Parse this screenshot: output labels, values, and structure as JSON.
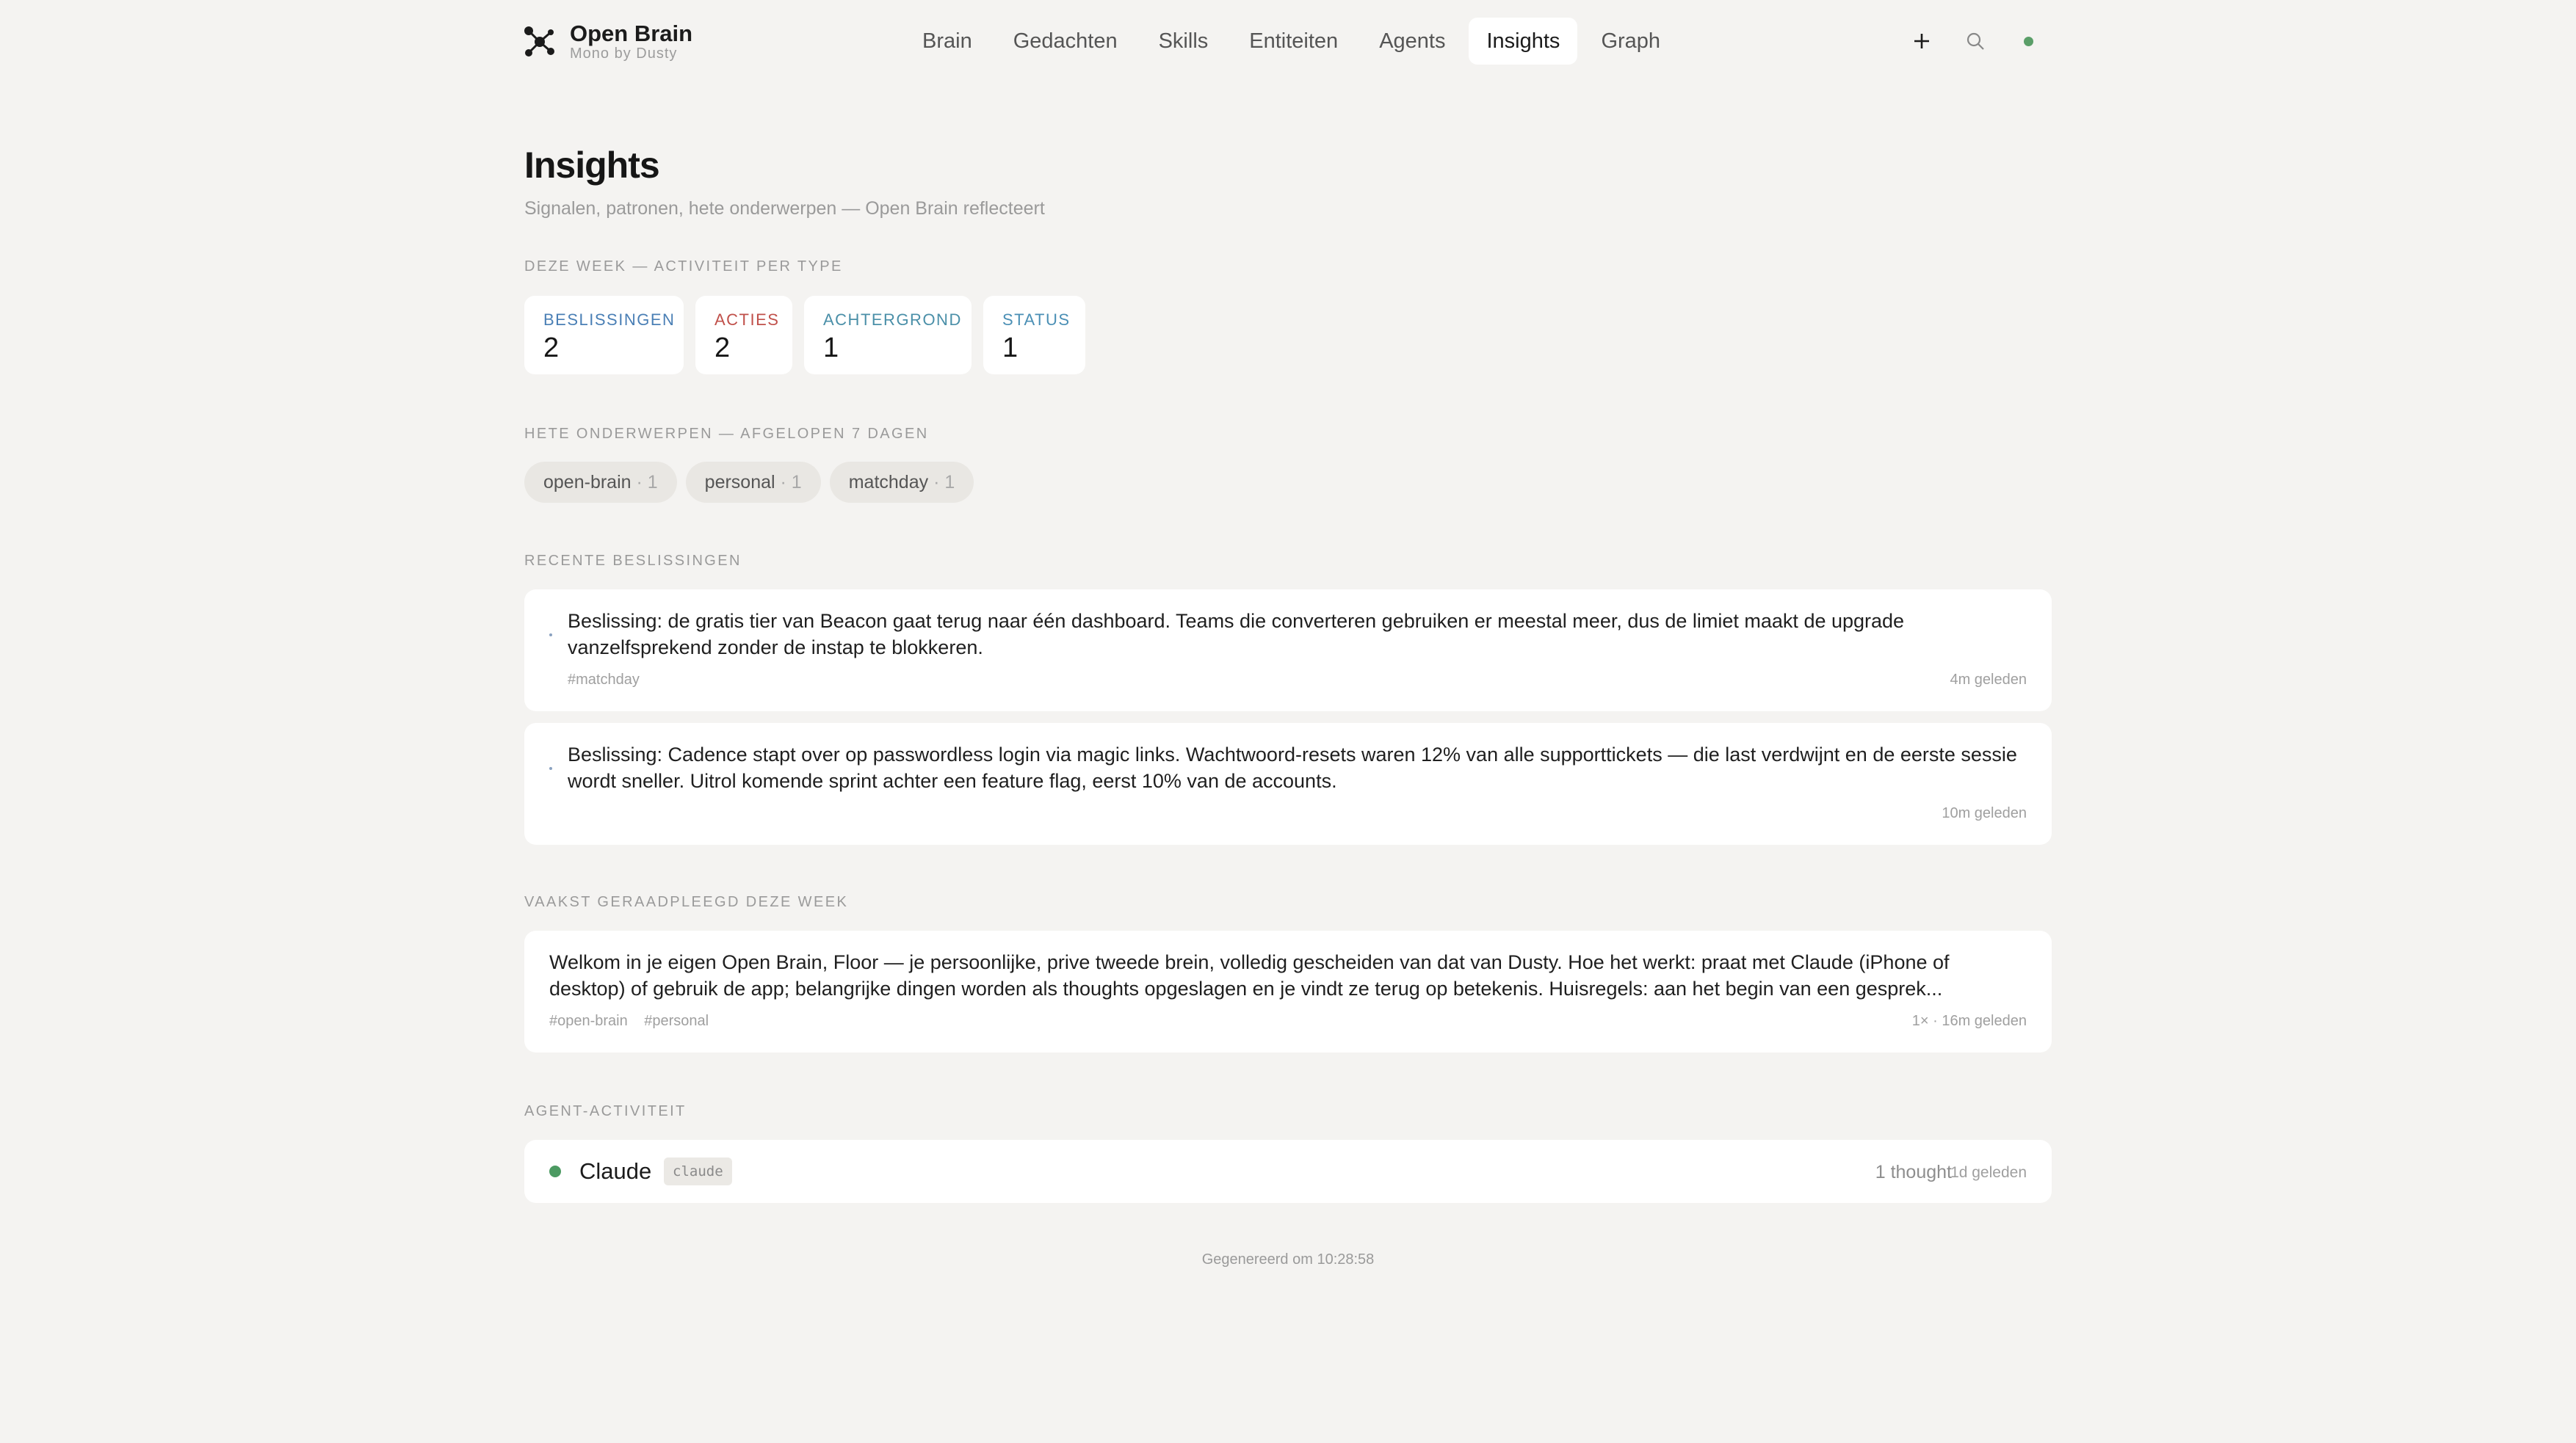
{
  "brand": {
    "name": "Open Brain",
    "sub": "Mono by Dusty"
  },
  "nav": {
    "items": [
      {
        "label": "Brain"
      },
      {
        "label": "Gedachten"
      },
      {
        "label": "Skills"
      },
      {
        "label": "Entiteiten"
      },
      {
        "label": "Agents"
      },
      {
        "label": "Insights",
        "active": true
      },
      {
        "label": "Graph"
      }
    ]
  },
  "toolbar": {
    "add_icon": "plus-icon",
    "search_icon": "search-icon",
    "status_color": "#5a9e68"
  },
  "page": {
    "title": "Insights",
    "subtitle": "Signalen, patronen, hete onderwerpen — Open Brain reflecteert"
  },
  "activity": {
    "label": "DEZE WEEK — ACTIVITEIT PER TYPE",
    "stats": [
      {
        "label": "BESLISSINGEN",
        "value": "2",
        "color": "#4a7fb5"
      },
      {
        "label": "ACTIES",
        "value": "2",
        "color": "#c0504a"
      },
      {
        "label": "ACHTERGROND",
        "value": "1",
        "color": "#4a8fa8"
      },
      {
        "label": "STATUS",
        "value": "1",
        "color": "#4a8fb5"
      }
    ]
  },
  "hot_topics": {
    "label": "HETE ONDERWERPEN — AFGELOPEN 7 DAGEN",
    "chips": [
      {
        "name": "open-brain",
        "count": "· 1"
      },
      {
        "name": "personal",
        "count": "· 1"
      },
      {
        "name": "matchday",
        "count": "· 1"
      }
    ]
  },
  "recent_decisions": {
    "label": "RECENTE BESLISSINGEN",
    "items": [
      {
        "text": "Beslissing: de gratis tier van Beacon gaat terug naar één dashboard. Teams die converteren gebruiken er meestal meer, dus de limiet maakt de upgrade vanzelfsprekend zonder de instap te blokkeren.",
        "tag": "#matchday",
        "time": "4m geleden"
      },
      {
        "text": "Beslissing: Cadence stapt over op passwordless login via magic links. Wachtwoord-resets waren 12% van alle supporttickets — die last verdwijnt en de eerste sessie wordt sneller. Uitrol komende sprint achter een feature flag, eerst 10% van de accounts.",
        "tag": "",
        "time": "10m geleden"
      }
    ]
  },
  "most_consulted": {
    "label": "VAAKST GERAADPLEEGD DEZE WEEK",
    "item": {
      "text": "Welkom in je eigen Open Brain, Floor — je persoonlijke, prive tweede brein, volledig gescheiden van dat van Dusty. Hoe het werkt: praat met Claude (iPhone of desktop) of gebruik de app; belangrijke dingen worden als thoughts opgeslagen en je vindt ze terug op betekenis. Huisregels: aan het begin van een gesprek...",
      "tags": [
        "#open-brain",
        "#personal"
      ],
      "meta": "1× · 16m geleden"
    }
  },
  "agent_activity": {
    "label": "AGENT-ACTIVITEIT",
    "agent": {
      "name": "Claude",
      "tag": "claude",
      "count": "1 thought",
      "time": "1d geleden",
      "status_color": "#4c9a62"
    }
  },
  "footer": {
    "text": "Gegenereerd om 10:28:58"
  }
}
